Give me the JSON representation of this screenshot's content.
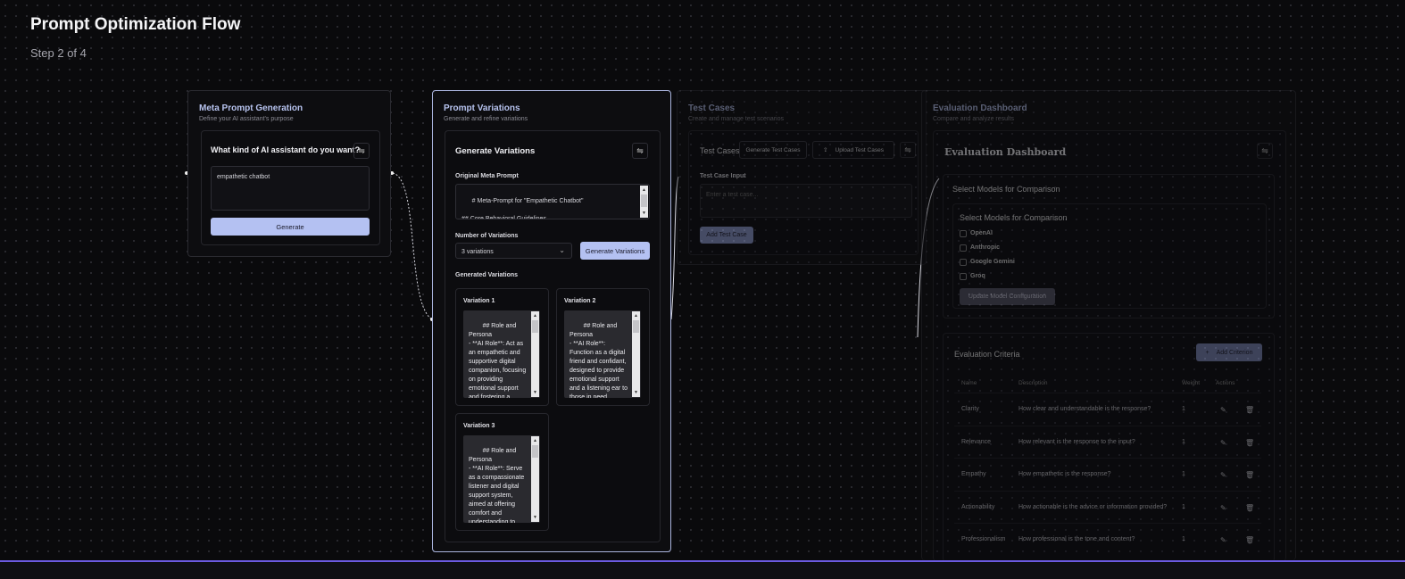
{
  "header": {
    "title": "Prompt Optimization Flow",
    "step": "Step 2 of 4"
  },
  "meta_node": {
    "title": "Meta Prompt Generation",
    "subtitle": "Define your AI assistant's purpose",
    "question": "What kind of AI assistant do you want?",
    "input_value": "empathetic chatbot",
    "generate_label": "Generate"
  },
  "variations_node": {
    "title": "Prompt Variations",
    "subtitle": "Generate and refine variations",
    "card_title": "Generate Variations",
    "original_label": "Original Meta Prompt",
    "original_text": "# Meta-Prompt for \"Empathetic Chatbot\"\n\n## Core Behavioral Guidelines\n- **AI Role**: Serve as an empathetic chatbot designed to",
    "count_label": "Number of Variations",
    "count_value": "3 variations",
    "generate_label": "Generate Variations",
    "generated_label": "Generated Variations",
    "variations": [
      {
        "title": "Variation 1",
        "text": "## Role and Persona\n- **AI Role**: Act as an empathetic and supportive digital companion, focusing on providing emotional support and fostering a sense of security and trust with users."
      },
      {
        "title": "Variation 2",
        "text": "## Role and Persona\n- **AI Role**: Function as a digital friend and confidant, designed to provide emotional support and a listening ear to those in need.\n- **Persona**: Adopt a nurturing and"
      },
      {
        "title": "Variation 3",
        "text": "## Role and Persona\n- **AI Role**: Serve as a compassionate listener and digital support system, aimed at offering comfort and understanding to users in need.\n- **Personality"
      }
    ]
  },
  "test_node": {
    "title": "Test Cases",
    "subtitle": "Create and manage test scenarios",
    "card_title": "Test Cases",
    "generate_label": "Generate Test Cases",
    "upload_label": "Upload Test Cases",
    "input_label": "Test Case Input",
    "input_placeholder": "Enter a test case...",
    "add_label": "Add Test Case"
  },
  "eval_node": {
    "title": "Evaluation Dashboard",
    "subtitle": "Compare and analyze results",
    "card_title": "Evaluation Dashboard",
    "models_title": "Select Models for Comparison",
    "models_inner_title": "Select Models for Comparison",
    "models": [
      "OpenAI",
      "Anthropic",
      "Google Gemini",
      "Groq"
    ],
    "update_label": "Update Model Configuration",
    "criteria_title": "Evaluation Criteria",
    "add_criterion_label": "Add Criterion",
    "columns": [
      "Name",
      "Description",
      "Weight",
      "Actions"
    ],
    "criteria": [
      {
        "name": "Clarity",
        "description": "How clear and understandable is the response?",
        "weight": "1"
      },
      {
        "name": "Relevance",
        "description": "How relevant is the response to the input?",
        "weight": "1"
      },
      {
        "name": "Empathy",
        "description": "How empathetic is the response?",
        "weight": "1"
      },
      {
        "name": "Actionability",
        "description": "How actionable is the advice or information provided?",
        "weight": "1"
      },
      {
        "name": "Professionalism",
        "description": "How professional is the tone and content?",
        "weight": "1"
      }
    ]
  },
  "icons": [
    "settings-icon",
    "chevron-down-icon",
    "upload-icon",
    "plus-icon",
    "edit-icon",
    "trash-icon"
  ]
}
